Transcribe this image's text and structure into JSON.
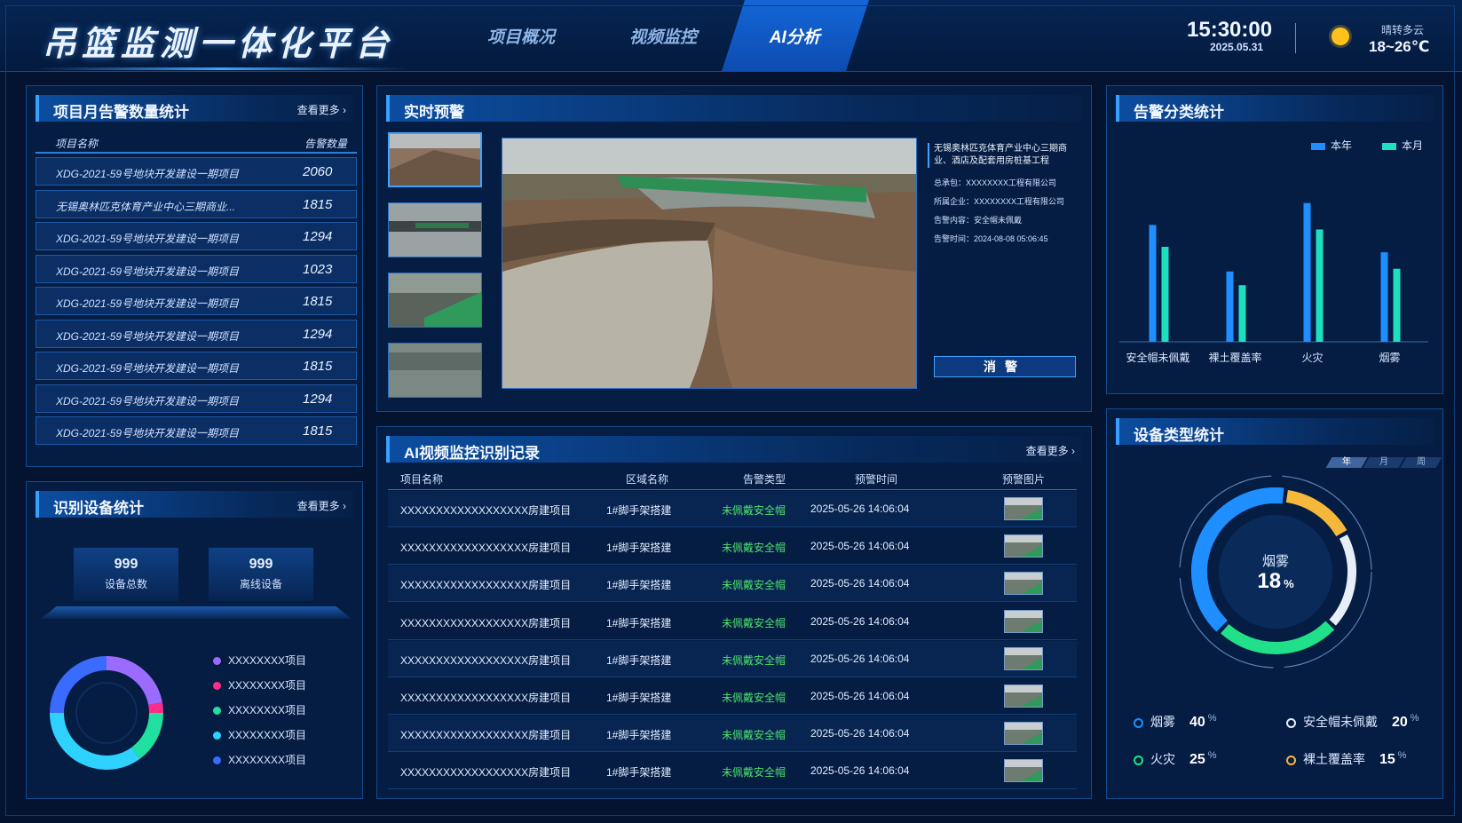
{
  "header": {
    "title": "吊篮监测一体化平台",
    "nav": [
      {
        "label": "项目概况",
        "active": false
      },
      {
        "label": "视频监控",
        "active": false
      },
      {
        "label": "AI分析",
        "active": true
      }
    ],
    "time": "15:30:00",
    "date": "2025.05.31",
    "weather": {
      "icon": "sun-icon",
      "desc": "晴转多云",
      "temp": "18~26℃"
    }
  },
  "alarm_stats": {
    "title": "项目月告警数量统计",
    "more": "查看更多 ›",
    "col_name": "项目名称",
    "col_count": "告警数量",
    "rows": [
      {
        "name": "XDG-2021-59号地块开发建设一期项目",
        "count": "2060"
      },
      {
        "name": "无锡奥林匹克体育产业中心三期商业...",
        "count": "1815"
      },
      {
        "name": "XDG-2021-59号地块开发建设一期项目",
        "count": "1294"
      },
      {
        "name": "XDG-2021-59号地块开发建设一期项目",
        "count": "1023"
      },
      {
        "name": "XDG-2021-59号地块开发建设一期项目",
        "count": "1815"
      },
      {
        "name": "XDG-2021-59号地块开发建设一期项目",
        "count": "1294"
      },
      {
        "name": "XDG-2021-59号地块开发建设一期项目",
        "count": "1815"
      },
      {
        "name": "XDG-2021-59号地块开发建设一期项目",
        "count": "1294"
      },
      {
        "name": "XDG-2021-59号地块开发建设一期项目",
        "count": "1815"
      }
    ]
  },
  "device_stats": {
    "title": "识别设备统计",
    "more": "查看更多 ›",
    "total": {
      "value": "999",
      "label": "设备总数"
    },
    "offline": {
      "value": "999",
      "label": "离线设备"
    },
    "legend": [
      {
        "label": "XXXXXXXX项目",
        "color": "#9b6bff"
      },
      {
        "label": "XXXXXXXX项目",
        "color": "#ff2d8a"
      },
      {
        "label": "XXXXXXXX项目",
        "color": "#20e0a0"
      },
      {
        "label": "XXXXXXXX项目",
        "color": "#2fd2ff"
      },
      {
        "label": "XXXXXXXX项目",
        "color": "#3a6bff"
      }
    ]
  },
  "realtime": {
    "title": "实时预警",
    "project": "无锡奥林匹克体育产业中心三期商业、酒店及配套用房桩基工程",
    "contractor": "总承包：XXXXXXXX工程有限公司",
    "company": "所属企业：XXXXXXXX工程有限公司",
    "content": "告警内容：安全帽未佩戴",
    "time": "告警时间：2024-08-08 05:06:45",
    "dismiss": "消警"
  },
  "records": {
    "title": "AI视频监控识别记录",
    "more": "查看更多 ›",
    "headers": [
      "项目名称",
      "区域名称",
      "告警类型",
      "预警时间",
      "预警图片"
    ],
    "rows": [
      {
        "project": "XXXXXXXXXXXXXXXXXX房建项目",
        "area": "1#脚手架搭建",
        "type": "未佩戴安全帽",
        "time": "2025-05-26  14:06:04"
      },
      {
        "project": "XXXXXXXXXXXXXXXXXX房建项目",
        "area": "1#脚手架搭建",
        "type": "未佩戴安全帽",
        "time": "2025-05-26  14:06:04"
      },
      {
        "project": "XXXXXXXXXXXXXXXXXX房建项目",
        "area": "1#脚手架搭建",
        "type": "未佩戴安全帽",
        "time": "2025-05-26  14:06:04"
      },
      {
        "project": "XXXXXXXXXXXXXXXXXX房建项目",
        "area": "1#脚手架搭建",
        "type": "未佩戴安全帽",
        "time": "2025-05-26  14:06:04"
      },
      {
        "project": "XXXXXXXXXXXXXXXXXX房建项目",
        "area": "1#脚手架搭建",
        "type": "未佩戴安全帽",
        "time": "2025-05-26  14:06:04"
      },
      {
        "project": "XXXXXXXXXXXXXXXXXX房建项目",
        "area": "1#脚手架搭建",
        "type": "未佩戴安全帽",
        "time": "2025-05-26  14:06:04"
      },
      {
        "project": "XXXXXXXXXXXXXXXXXX房建项目",
        "area": "1#脚手架搭建",
        "type": "未佩戴安全帽",
        "time": "2025-05-26  14:06:04"
      },
      {
        "project": "XXXXXXXXXXXXXXXXXX房建项目",
        "area": "1#脚手架搭建",
        "type": "未佩戴安全帽",
        "time": "2025-05-26  14:06:04"
      }
    ]
  },
  "alarm_category": {
    "title": "告警分类统计",
    "legend_year": "本年",
    "legend_month": "本月",
    "year_color": "#1f8fff",
    "month_color": "#1ee0c0"
  },
  "device_type": {
    "title": "设备类型统计",
    "tabs": [
      "年",
      "月",
      "周"
    ],
    "center_label": "烟雾",
    "center_value": "18",
    "center_unit": "%",
    "legend": [
      {
        "label": "烟雾",
        "value": "40",
        "unit": "%",
        "color": "#1f8fff"
      },
      {
        "label": "安全帽未佩戴",
        "value": "20",
        "unit": "%",
        "color": "#e8eef8"
      },
      {
        "label": "火灾",
        "value": "25",
        "unit": "%",
        "color": "#20e08a"
      },
      {
        "label": "裸土覆盖率",
        "value": "15",
        "unit": "%",
        "color": "#f5b83a"
      }
    ]
  },
  "chart_data": [
    {
      "type": "bar",
      "title": "告警分类统计",
      "categories": [
        "安全帽未佩戴",
        "裸土覆盖率",
        "火灾",
        "烟雾"
      ],
      "series": [
        {
          "name": "本年",
          "values": [
            128,
            77,
            152,
            98
          ]
        },
        {
          "name": "本月",
          "values": [
            104,
            62,
            123,
            80
          ]
        }
      ],
      "ylim": [
        0,
        175
      ],
      "legend": "top-right",
      "grid": false
    },
    {
      "type": "pie",
      "title": "设备类型统计",
      "categories": [
        "烟雾",
        "安全帽未佩戴",
        "火灾",
        "裸土覆盖率"
      ],
      "values": [
        40,
        20,
        25,
        15
      ]
    },
    {
      "type": "pie",
      "title": "识别设备统计",
      "categories": [
        "XXXXXXXX项目",
        "XXXXXXXX项目",
        "XXXXXXXX项目",
        "XXXXXXXX项目",
        "XXXXXXXX项目"
      ],
      "values": [
        22,
        3,
        15,
        35,
        25
      ]
    }
  ]
}
